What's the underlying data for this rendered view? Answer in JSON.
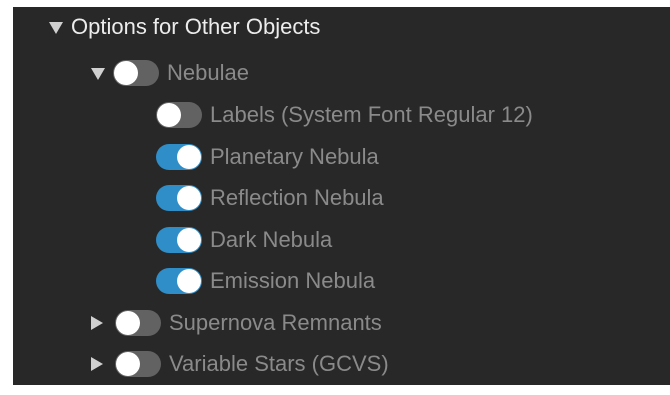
{
  "section": {
    "title": "Options for Other Objects",
    "expanded": true
  },
  "nebulae": {
    "label": "Nebulae",
    "expanded": true,
    "enabled": false,
    "children": [
      {
        "label": "Labels (System Font Regular 12)",
        "enabled": false
      },
      {
        "label": "Planetary Nebula",
        "enabled": true
      },
      {
        "label": "Reflection Nebula",
        "enabled": true
      },
      {
        "label": "Dark Nebula",
        "enabled": true
      },
      {
        "label": "Emission Nebula",
        "enabled": true
      }
    ]
  },
  "supernova_remnants": {
    "label": "Supernova Remnants",
    "expanded": false,
    "enabled": false
  },
  "variable_stars": {
    "label": "Variable Stars (GCVS)",
    "expanded": false,
    "enabled": false
  },
  "colors": {
    "panel_background": "#282828",
    "toggle_on": "#2f8dc8",
    "toggle_off": "#626262",
    "dim_text": "#8a8a8a",
    "header_text": "#ececec"
  }
}
